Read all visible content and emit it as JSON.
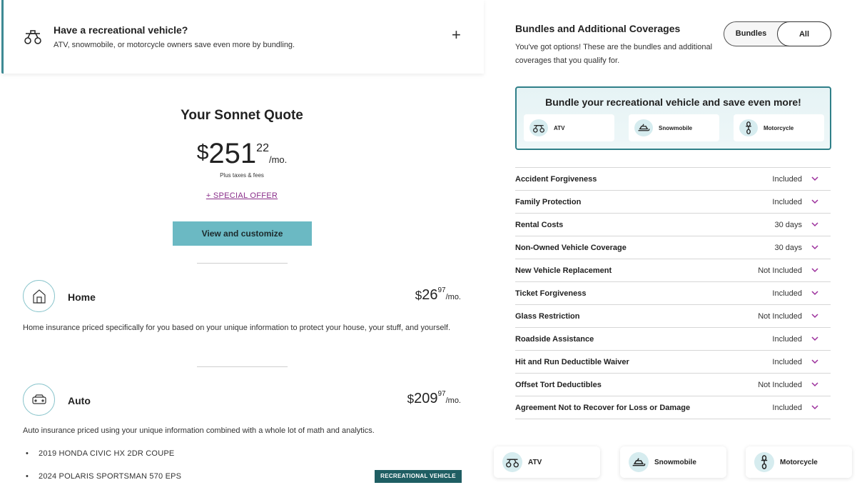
{
  "rv_banner": {
    "title": "Have a recreational vehicle?",
    "subtitle": "ATV, snowmobile, or motorcycle owners save even more by bundling.",
    "expand_symbol": "+"
  },
  "quote": {
    "title": "Your Sonnet Quote",
    "currency": "$",
    "whole": "251",
    "cents": "22",
    "per": "/mo.",
    "taxes_note": "Plus taxes & fees",
    "special_offer": "+ SPECIAL OFFER",
    "view_button": "View and customize"
  },
  "products": [
    {
      "name": "Home",
      "icon": "house-icon",
      "currency": "$",
      "whole": "26",
      "cents": "97",
      "per": "/mo.",
      "description": "Home insurance priced specifically for you based on your unique information to protect your house, your stuff, and yourself."
    },
    {
      "name": "Auto",
      "icon": "car-icon",
      "currency": "$",
      "whole": "209",
      "cents": "97",
      "per": "/mo.",
      "description": "Auto insurance priced using your unique information combined with a whole lot of math and analytics.",
      "vehicles": [
        "2019 HONDA CIVIC HX 2DR COUPE",
        "2024 POLARIS SPORTSMAN 570 EPS"
      ],
      "vehicle_bullet": "•",
      "rv_badge": "RECREATIONAL VEHICLE"
    }
  ],
  "coverages_panel": {
    "title": "Bundles and Additional Coverages",
    "subtitle": "You've got options! These are the bundles and additional coverages that you qualify for.",
    "toggle": {
      "bundles": "Bundles",
      "all": "All",
      "selected": "All"
    },
    "bundle_box": {
      "title": "Bundle your recreational vehicle and save even more!",
      "cards": [
        {
          "label": "ATV",
          "icon": "atv-icon"
        },
        {
          "label": "Snowmobile",
          "icon": "snowmobile-icon"
        },
        {
          "label": "Motorcycle",
          "icon": "motorcycle-icon"
        }
      ]
    },
    "coverages": [
      {
        "name": "Accident Forgiveness",
        "value": "Included"
      },
      {
        "name": "Family Protection",
        "value": "Included"
      },
      {
        "name": "Rental Costs",
        "value": "30 days"
      },
      {
        "name": "Non-Owned Vehicle Coverage",
        "value": "30 days"
      },
      {
        "name": "New Vehicle Replacement",
        "value": "Not Included"
      },
      {
        "name": "Ticket Forgiveness",
        "value": "Included"
      },
      {
        "name": "Glass Restriction",
        "value": "Not Included"
      },
      {
        "name": "Roadside Assistance",
        "value": "Included"
      },
      {
        "name": "Hit and Run Deductible Waiver",
        "value": "Included"
      },
      {
        "name": "Offset Tort Deductibles",
        "value": "Not Included"
      },
      {
        "name": "Agreement Not to Recover for Loss or Damage",
        "value": "Included"
      }
    ]
  },
  "bottom_cards": [
    {
      "label": "ATV",
      "icon": "atv-icon"
    },
    {
      "label": "Snowmobile",
      "icon": "snowmobile-icon"
    },
    {
      "label": "Motorcycle",
      "icon": "motorcycle-icon"
    }
  ],
  "colors": {
    "accent_teal": "#6bb9c3",
    "dark_teal": "#1f5e63",
    "chevron_purple": "#9b2e9b",
    "special_offer_purple": "#8a2e8a"
  }
}
